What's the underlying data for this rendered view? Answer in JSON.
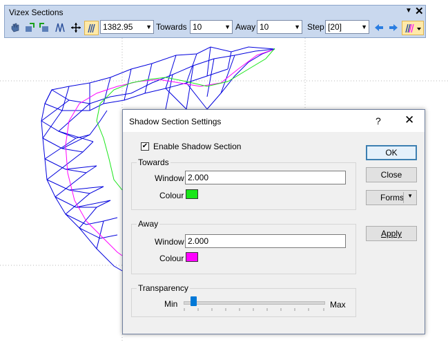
{
  "toolbar": {
    "title": "Vizex Sections",
    "section_value": "1382.95",
    "towards_label": "Towards",
    "towards_value": "10",
    "away_label": "Away",
    "away_value": "10",
    "step_label": "Step",
    "step_value": "[20]",
    "icons": [
      "hand-icon",
      "section-forward-icon",
      "section-back-icon",
      "section-network-icon",
      "move-icon",
      "shadow-section-icon",
      "previous-arrow-icon",
      "next-arrow-icon",
      "shadow-dropdown-icon"
    ]
  },
  "dialog": {
    "title": "Shadow Section Settings",
    "help": "?",
    "close_glyph": "✕",
    "enable_label": "Enable Shadow Section",
    "enable_checked": true,
    "towards": {
      "legend": "Towards",
      "window_label": "Window",
      "window_value": "2.000",
      "colour_label": "Colour",
      "colour": "#19e619"
    },
    "away": {
      "legend": "Away",
      "window_label": "Window",
      "window_value": "2.000",
      "colour_label": "Colour",
      "colour": "#ff00ff"
    },
    "transparency": {
      "legend": "Transparency",
      "min_label": "Min",
      "max_label": "Max",
      "value_fraction": 0.07
    },
    "buttons": {
      "ok": "OK",
      "close": "Close",
      "forms": "Forms",
      "apply": "Apply"
    }
  },
  "colors": {
    "mesh": "#0000dd",
    "toolbar_bg": "#c9d8ee",
    "accent": "#0078d7"
  }
}
